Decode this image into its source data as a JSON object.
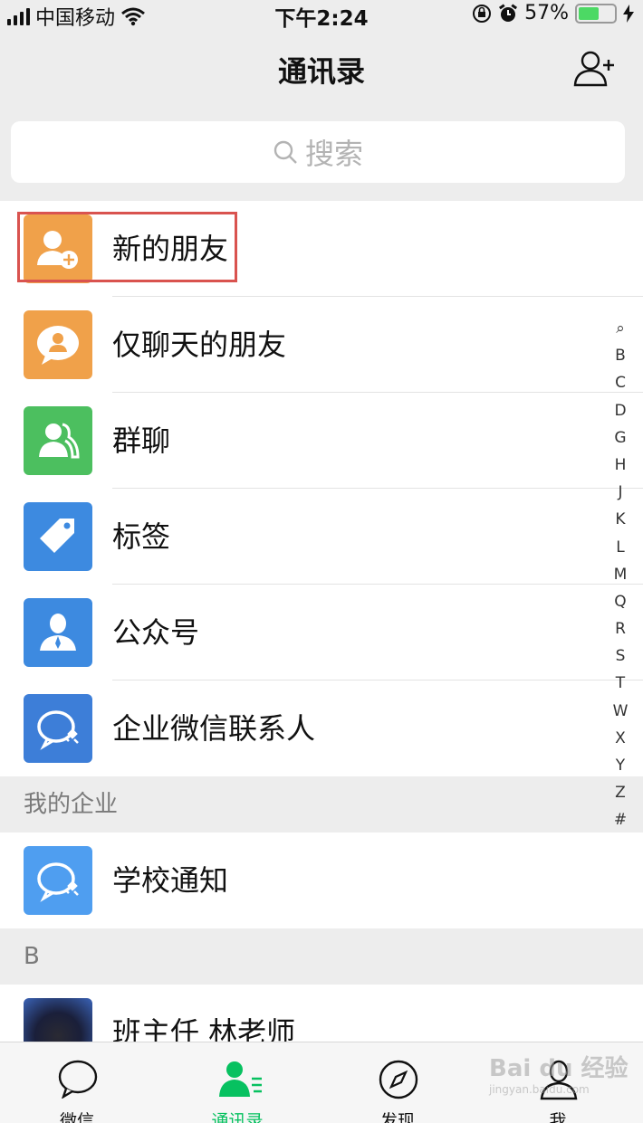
{
  "status": {
    "carrier": "中国移动",
    "time": "下午2:24",
    "battery": "57%",
    "battery_level": 0.57
  },
  "nav": {
    "title": "通讯录"
  },
  "search": {
    "placeholder": "搜索"
  },
  "items": [
    {
      "label": "新的朋友",
      "icon": "new-friend-icon",
      "color": "#f0a14a"
    },
    {
      "label": "仅聊天的朋友",
      "icon": "chat-only-friend-icon",
      "color": "#f0a14a"
    },
    {
      "label": "群聊",
      "icon": "group-chat-icon",
      "color": "#4cbf5f"
    },
    {
      "label": "标签",
      "icon": "tag-icon",
      "color": "#3d8ae0"
    },
    {
      "label": "公众号",
      "icon": "official-account-icon",
      "color": "#3d8ae0"
    },
    {
      "label": "企业微信联系人",
      "icon": "work-wechat-icon",
      "color": "#3d7ed8"
    }
  ],
  "sections": [
    {
      "title": "我的企业",
      "items": [
        {
          "label": "学校通知",
          "icon": "school-notice-icon",
          "color": "#4f9ef0"
        }
      ]
    },
    {
      "title": "B",
      "items": [
        {
          "label": "班主任 林老师",
          "icon": "avatar"
        }
      ]
    }
  ],
  "index": [
    "Q",
    "B",
    "C",
    "D",
    "G",
    "H",
    "J",
    "K",
    "L",
    "M",
    "Q",
    "R",
    "S",
    "T",
    "W",
    "X",
    "Y",
    "Z",
    "#"
  ],
  "tabs": [
    {
      "label": "微信",
      "icon": "chat-bubble-icon",
      "active": false
    },
    {
      "label": "通讯录",
      "icon": "contacts-icon",
      "active": true
    },
    {
      "label": "发现",
      "icon": "compass-icon",
      "active": false
    },
    {
      "label": "我",
      "icon": "person-icon",
      "active": false
    }
  ],
  "watermark": {
    "brand": "Bai du 经验",
    "url": "jingyan.baidu.com"
  },
  "colors": {
    "accent": "#07c160",
    "highlight": "#d9534f"
  }
}
